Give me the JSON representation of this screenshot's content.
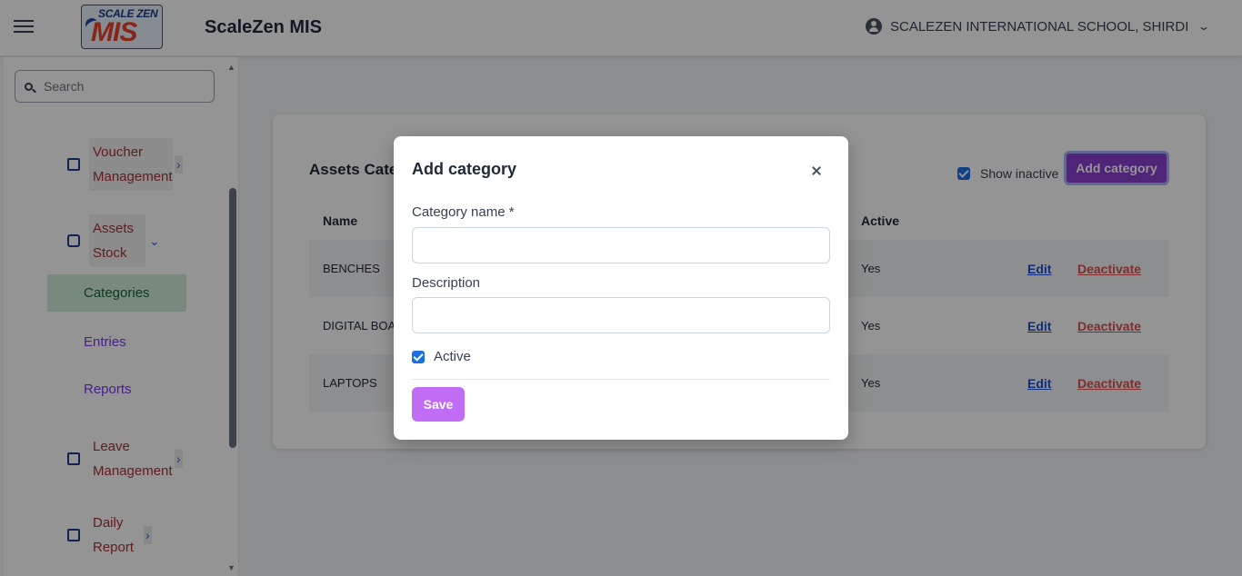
{
  "header": {
    "app_title": "ScaleZen MIS",
    "logo_top": "SCALE ZEN",
    "logo_main": "MIS",
    "school_name": "SCALEZEN INTERNATIONAL SCHOOL, SHIRDI",
    "menu_icon": "hamburger-icon",
    "account_icon": "account-circle-icon"
  },
  "sidebar": {
    "search_placeholder": "Search",
    "items": [
      {
        "label": "Voucher Management",
        "icon": "wallet-icon"
      },
      {
        "label": "Assets Stock",
        "icon": "box-icon"
      },
      {
        "label": "Leave Management",
        "icon": "calendar-clock-icon"
      },
      {
        "label": "Daily Report",
        "icon": "calendar-icon"
      }
    ],
    "assets_subitems": [
      {
        "label": "Categories",
        "active": true
      },
      {
        "label": "Entries"
      },
      {
        "label": "Reports"
      }
    ]
  },
  "page": {
    "title": "Assets Cate",
    "show_inactive_label": "Show inactive",
    "show_inactive_checked": true,
    "add_button_label": "Add category",
    "columns": [
      "Name",
      "Active"
    ],
    "rows": [
      {
        "name": "BENCHES",
        "active": "Yes",
        "edit": "Edit",
        "deactivate": "Deactivate"
      },
      {
        "name": "DIGITAL BOA",
        "active": "Yes",
        "edit": "Edit",
        "deactivate": "Deactivate"
      },
      {
        "name": "LAPTOPS",
        "active": "Yes",
        "edit": "Edit",
        "deactivate": "Deactivate"
      }
    ]
  },
  "modal": {
    "title": "Add category",
    "category_name_label": "Category name *",
    "category_name_value": "",
    "description_label": "Description",
    "description_value": "",
    "active_label": "Active",
    "active_checked": true,
    "save_label": "Save"
  },
  "colors": {
    "accent_purple": "#8b3fd1",
    "save_purple": "#c06cf5",
    "link_blue": "#1d4ed8",
    "deactivate_red": "#dc4e4e"
  }
}
